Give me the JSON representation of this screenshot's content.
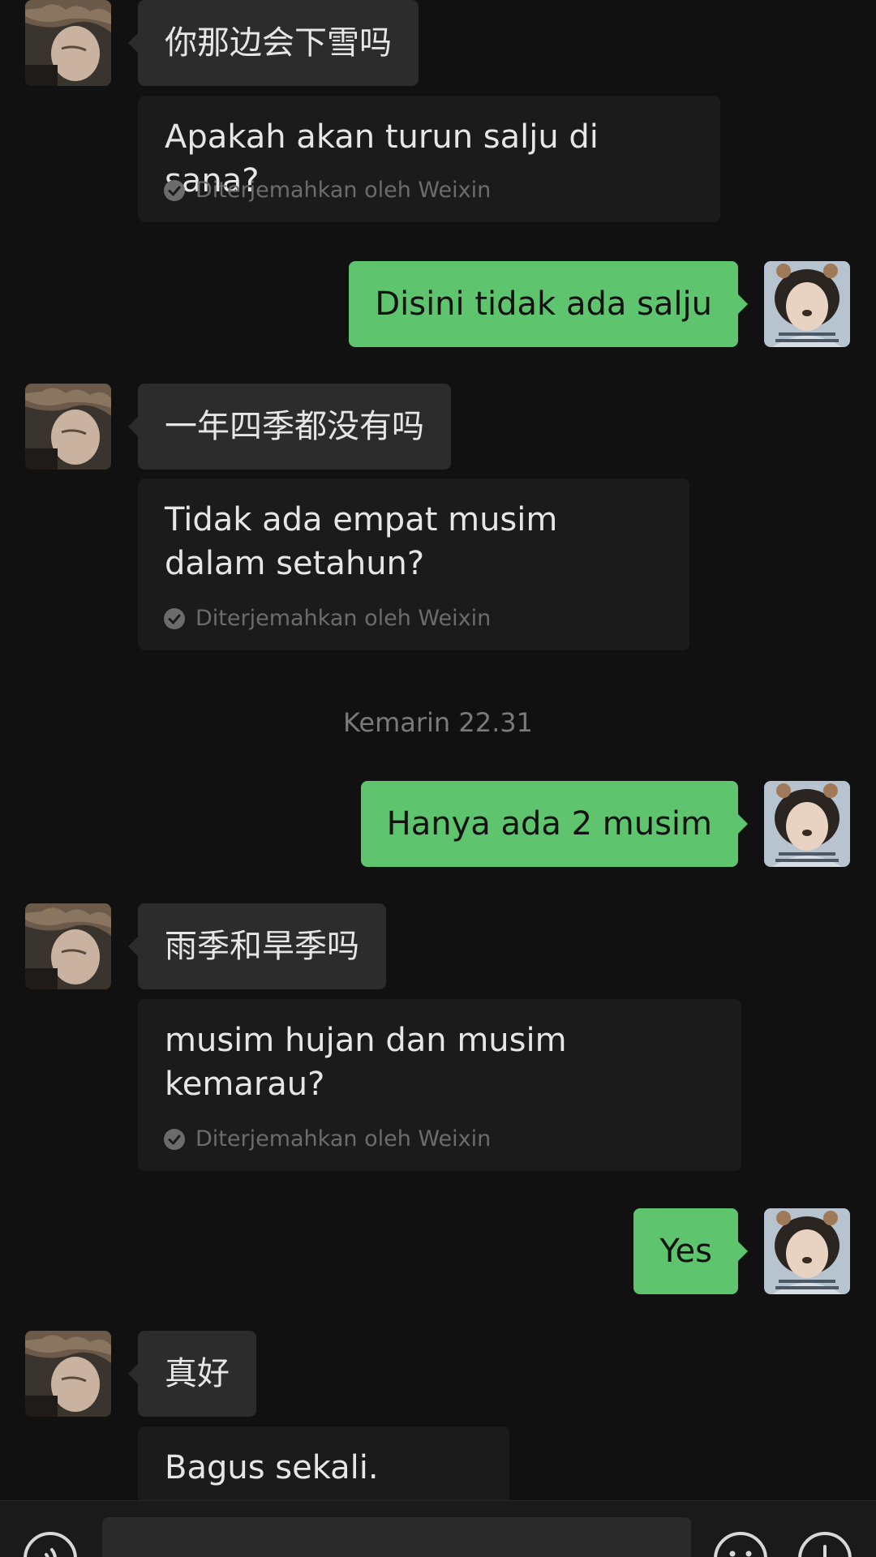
{
  "messages": [
    {
      "side": "in",
      "text": "你那边会下雪吗",
      "translation": "Apakah akan turun salju di sana?",
      "translation_note": "Diterjemahkan oleh Weixin"
    },
    {
      "side": "out",
      "text": "Disini tidak ada salju"
    },
    {
      "side": "in",
      "text": "一年四季都没有吗",
      "translation": "Tidak ada empat musim dalam setahun?",
      "translation_note": "Diterjemahkan oleh Weixin"
    },
    {
      "side": "out",
      "text": "Hanya ada 2 musim"
    },
    {
      "side": "in",
      "text": "雨季和旱季吗",
      "translation": "musim hujan dan musim kemarau?",
      "translation_note": "Diterjemahkan oleh Weixin"
    },
    {
      "side": "out",
      "text": "Yes"
    },
    {
      "side": "in",
      "text": "真好",
      "translation": "Bagus sekali."
    }
  ],
  "timestamp": "Kemarin 22.31",
  "colors": {
    "background": "#111111",
    "incoming_bubble": "#2c2c2c",
    "translation_bubble": "#1b1b1b",
    "outgoing_bubble": "#5fc46e"
  },
  "icons": {
    "voice": "voice-input-icon",
    "emoji": "emoji-icon",
    "more": "more-plus-icon",
    "translated": "check-circle-icon"
  }
}
